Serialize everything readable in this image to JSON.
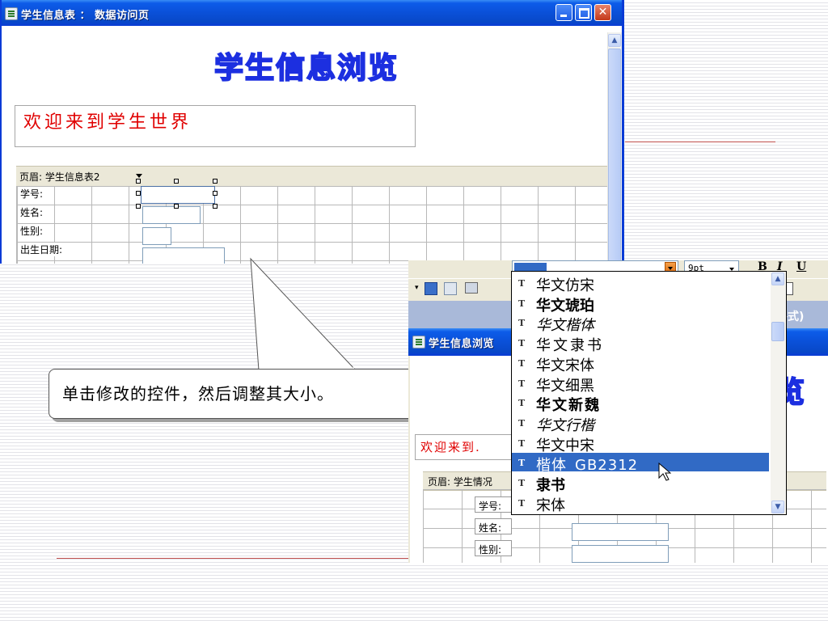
{
  "main_window": {
    "title": "学生信息表 ： 数据访问页",
    "page_title": "学生信息浏览",
    "welcome_text": "欢迎来到学生世界",
    "header_label": "页眉: 学生信息表2",
    "fields": [
      "学号:",
      "姓名:",
      "性别:",
      "出生日期:"
    ]
  },
  "callout": {
    "text": "单击修改的控件，然后调整其大小。"
  },
  "second_window": {
    "title": "学生信息浏览",
    "page_title_partial": "览",
    "welcome_text_partial": "欢迎来到.",
    "header_label": "页眉: 学生情况",
    "fields": [
      "学号:",
      "姓名:",
      "性别:"
    ],
    "format_suffix": "格式)",
    "font_size": "9pt",
    "bold_label": "B",
    "italic_label": "I",
    "underline_label": "U"
  },
  "font_list": {
    "items": [
      {
        "name": "华文仿宋"
      },
      {
        "name": "华文琥珀"
      },
      {
        "name": "华文楷体"
      },
      {
        "name": "华文隶书"
      },
      {
        "name": "华文宋体"
      },
      {
        "name": "华文细黑"
      },
      {
        "name": "华文新魏"
      },
      {
        "name": "华文行楷"
      },
      {
        "name": "华文中宋"
      },
      {
        "name": "楷体_GB2312",
        "selected": true
      },
      {
        "name": "隶书"
      },
      {
        "name": "宋体"
      }
    ],
    "icon_glyph": "T"
  },
  "colors": {
    "title_bar": "#0a50d8",
    "page_title_outline": "#1c2fe0",
    "welcome_red": "#e00000",
    "selection": "#316ac5",
    "header_band": "#ebe8d8"
  }
}
